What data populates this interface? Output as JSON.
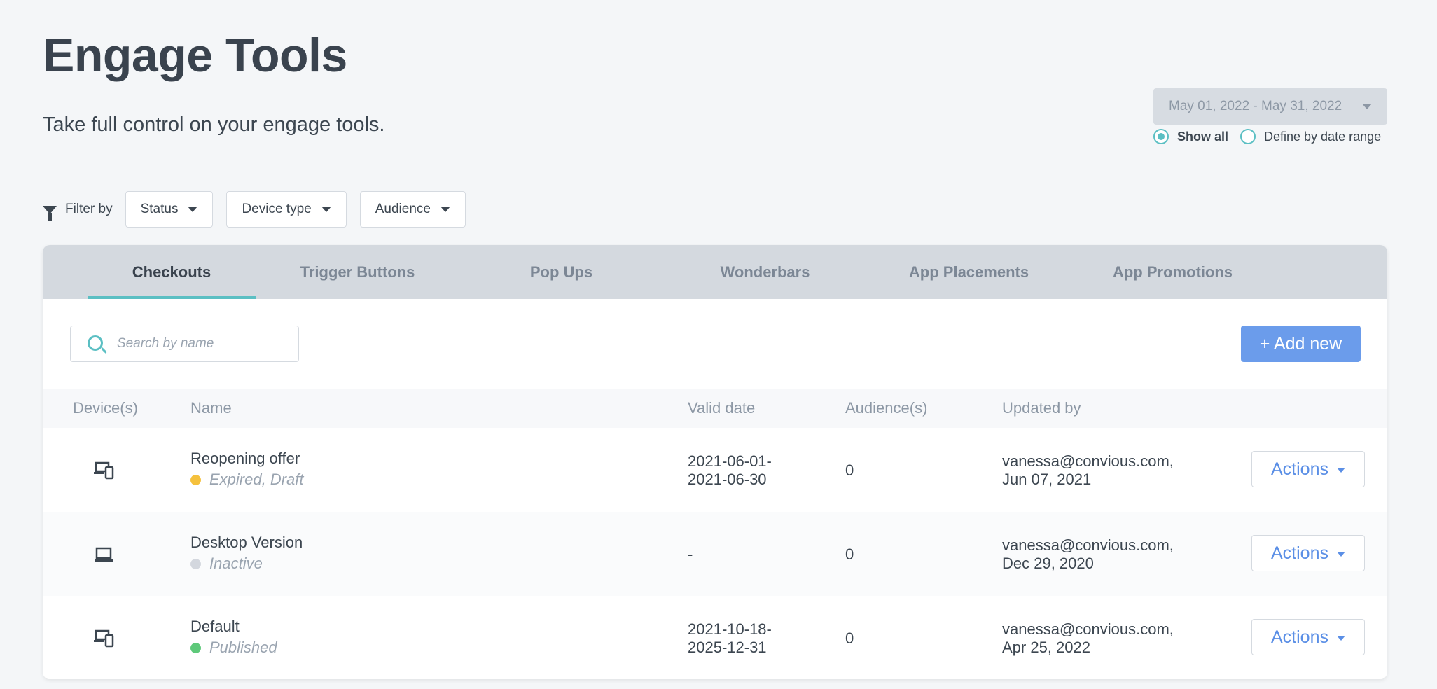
{
  "header": {
    "title": "Engage Tools",
    "subtitle": "Take full control on your engage tools."
  },
  "date_filter": {
    "range_value": "May 01, 2022 - May 31, 2022",
    "options": [
      {
        "label": "Show all",
        "selected": true
      },
      {
        "label": "Define by date range",
        "selected": false
      }
    ]
  },
  "filters": {
    "label": "Filter by",
    "buttons": [
      "Status",
      "Device type",
      "Audience"
    ]
  },
  "tabs": [
    "Checkouts",
    "Trigger Buttons",
    "Pop Ups",
    "Wonderbars",
    "App Placements",
    "App Promotions"
  ],
  "active_tab": "Checkouts",
  "search": {
    "placeholder": "Search by name"
  },
  "add_button": "+ Add new",
  "table": {
    "columns": [
      "Device(s)",
      "Name",
      "Valid date",
      "Audience(s)",
      "Updated by"
    ],
    "rows": [
      {
        "device": "desktop-mobile-icon",
        "name": "Reopening offer",
        "status": "Expired, Draft",
        "status_color": "#f5c13d",
        "valid_line1": "2021-06-01-",
        "valid_line2": "2021-06-30",
        "audiences": "0",
        "updated_line1": "vanessa@convious.com,",
        "updated_line2": "Jun 07, 2021",
        "action": "Actions"
      },
      {
        "device": "laptop-icon",
        "name": "Desktop Version",
        "status": "Inactive",
        "status_color": "#d3d7de",
        "valid_line1": "-",
        "valid_line2": "",
        "audiences": "0",
        "updated_line1": "vanessa@convious.com,",
        "updated_line2": "Dec 29, 2020",
        "action": "Actions"
      },
      {
        "device": "desktop-mobile-icon",
        "name": "Default",
        "status": "Published",
        "status_color": "#5ec97a",
        "valid_line1": "2021-10-18-",
        "valid_line2": "2025-12-31",
        "audiences": "0",
        "updated_line1": "vanessa@convious.com,",
        "updated_line2": "Apr 25, 2022",
        "action": "Actions"
      }
    ]
  }
}
